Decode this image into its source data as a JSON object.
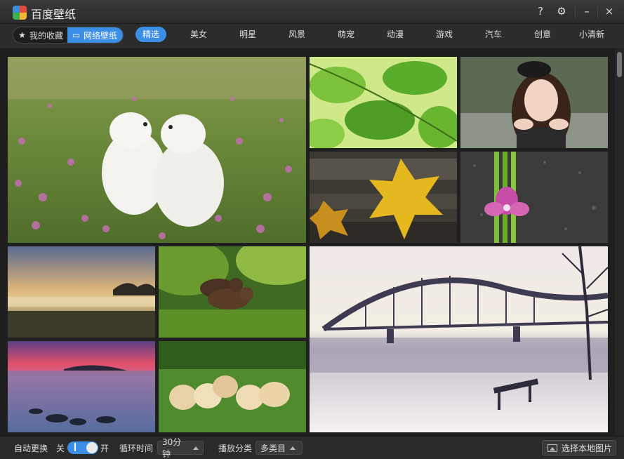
{
  "app": {
    "title": "百度壁纸"
  },
  "window": {
    "help_icon": "?",
    "gear_icon": "⚙",
    "minimize_icon": "–",
    "close_icon": "×"
  },
  "nav": {
    "favorites_label": "我的收藏",
    "web_label": "网络壁纸",
    "categories": [
      "精选",
      "美女",
      "明星",
      "风景",
      "萌宠",
      "动漫",
      "游戏",
      "汽车",
      "创意",
      "小清新"
    ],
    "active_category": "精选"
  },
  "tiles": [
    "white-puppies-flower-field",
    "green-leaves",
    "girl-portrait",
    "yellow-autumn-leaf",
    "orchid-bamboo-water-drops",
    "foggy-sunrise-field",
    "bear-cubs",
    "bridge-winter-lake",
    "sunset-sea-rocks",
    "golden-puppies-grass"
  ],
  "status": {
    "auto_change_label": "自动更换",
    "toggle_off_label": "关",
    "toggle_on_label": "开",
    "toggle_state": "on",
    "cycle_label": "循环时间",
    "cycle_value": "30分钟",
    "category_label": "播放分类",
    "category_value": "多类目",
    "local_button_label": "选择本地图片"
  },
  "colors": {
    "accent": "#3a8ee6",
    "background": "#222222"
  }
}
